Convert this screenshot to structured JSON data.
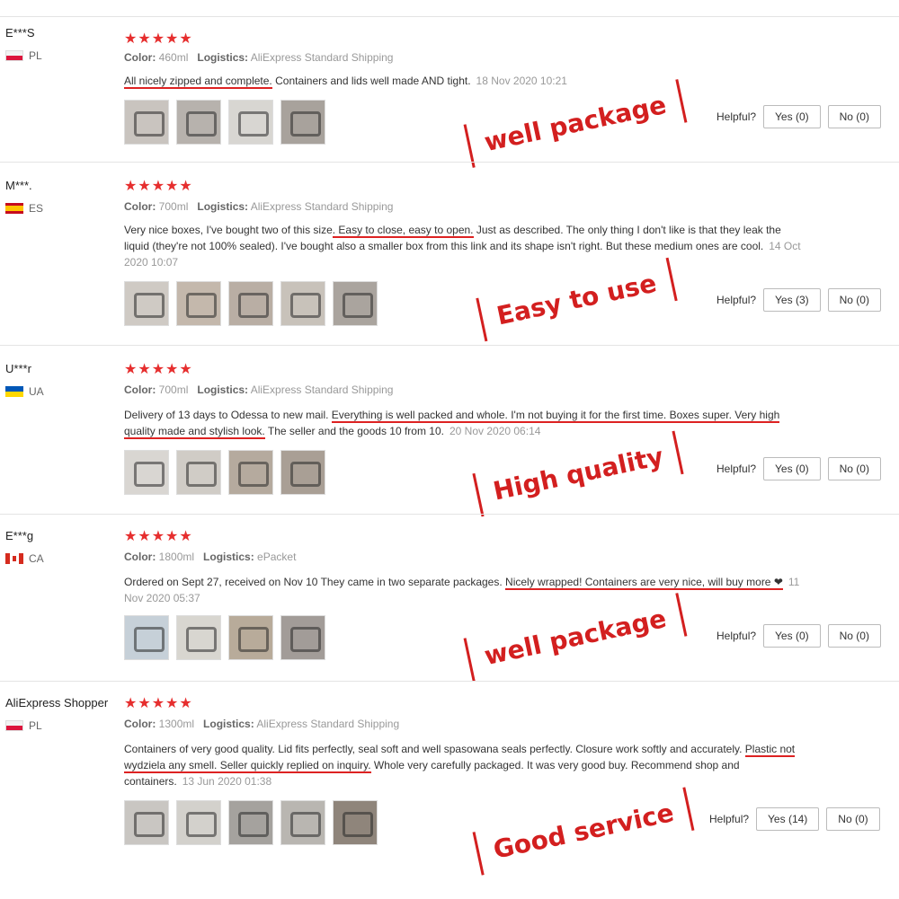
{
  "reviews": [
    {
      "user": "E***S",
      "country": "PL",
      "stars": "★★★★★",
      "color_label": "Color:",
      "color_value": "460ml",
      "logistics_label": "Logistics:",
      "logistics_value": "AliExpress Standard Shipping",
      "text_underlined_1": "All nicely zipped and complete.",
      "text_rest": " Containers and lids well made AND tight.",
      "date": "18 Nov 2020 10:21",
      "thumbs": 4,
      "helpful_label": "Helpful?",
      "yes_label": "Yes (0)",
      "no_label": "No (0)",
      "stamp": "well package"
    },
    {
      "user": "M***.",
      "country": "ES",
      "stars": "★★★★★",
      "color_label": "Color:",
      "color_value": "700ml",
      "logistics_label": "Logistics:",
      "logistics_value": "AliExpress Standard Shipping",
      "text_pre": "Very nice boxes, I've bought two of this size",
      "text_underlined_1": ". Easy to close, easy to open.",
      "text_rest": " Just as described. The only thing I don't like is that they leak the liquid (they're not 100% sealed). I've bought also a smaller box from this link and its shape isn't right. But these medium ones are cool.",
      "date": "14 Oct 2020 10:07",
      "thumbs": 5,
      "helpful_label": "Helpful?",
      "yes_label": "Yes (3)",
      "no_label": "No (0)",
      "stamp": "Easy to use"
    },
    {
      "user": "U***r",
      "country": "UA",
      "stars": "★★★★★",
      "color_label": "Color:",
      "color_value": "700ml",
      "logistics_label": "Logistics:",
      "logistics_value": "AliExpress Standard Shipping",
      "text_pre": "Delivery of 13 days to Odessa to new mail. ",
      "text_underlined_1": "Everything is well packed and whole. I'm not buying it for the first time. Boxes super. Very high quality made and stylish look.",
      "text_rest": " The seller and the goods 10 from 10.",
      "date": "20 Nov 2020 06:14",
      "thumbs": 4,
      "helpful_label": "Helpful?",
      "yes_label": "Yes (0)",
      "no_label": "No (0)",
      "stamp": "High quality"
    },
    {
      "user": "E***g",
      "country": "CA",
      "stars": "★★★★★",
      "color_label": "Color:",
      "color_value": "1800ml",
      "logistics_label": "Logistics:",
      "logistics_value": "ePacket",
      "text_pre": "Ordered on Sept 27, received on Nov 10 They came in two separate packages. ",
      "text_underlined_1": "Nicely wrapped! Containers are very nice, will buy more ❤",
      "text_rest": "",
      "date": "11 Nov 2020 05:37",
      "thumbs": 4,
      "helpful_label": "Helpful?",
      "yes_label": "Yes (0)",
      "no_label": "No (0)",
      "stamp": "well package"
    },
    {
      "user": "AliExpress Shopper",
      "country": "PL",
      "stars": "★★★★★",
      "color_label": "Color:",
      "color_value": "1300ml",
      "logistics_label": "Logistics:",
      "logistics_value": "AliExpress Standard Shipping",
      "text_pre": "Containers of very good quality. Lid fits perfectly, seal soft and well spasowana seals perfectly. Closure work softly and accurately. ",
      "text_underlined_1": "Plastic not wydziela any smell. Seller quickly replied on inquiry.",
      "text_rest": " Whole very carefully packaged. It was very good buy. Recommend shop and containers.",
      "date": "13 Jun 2020 01:38",
      "thumbs": 5,
      "helpful_label": "Helpful?",
      "yes_label": "Yes (14)",
      "no_label": "No (0)",
      "stamp": "Good service"
    }
  ]
}
